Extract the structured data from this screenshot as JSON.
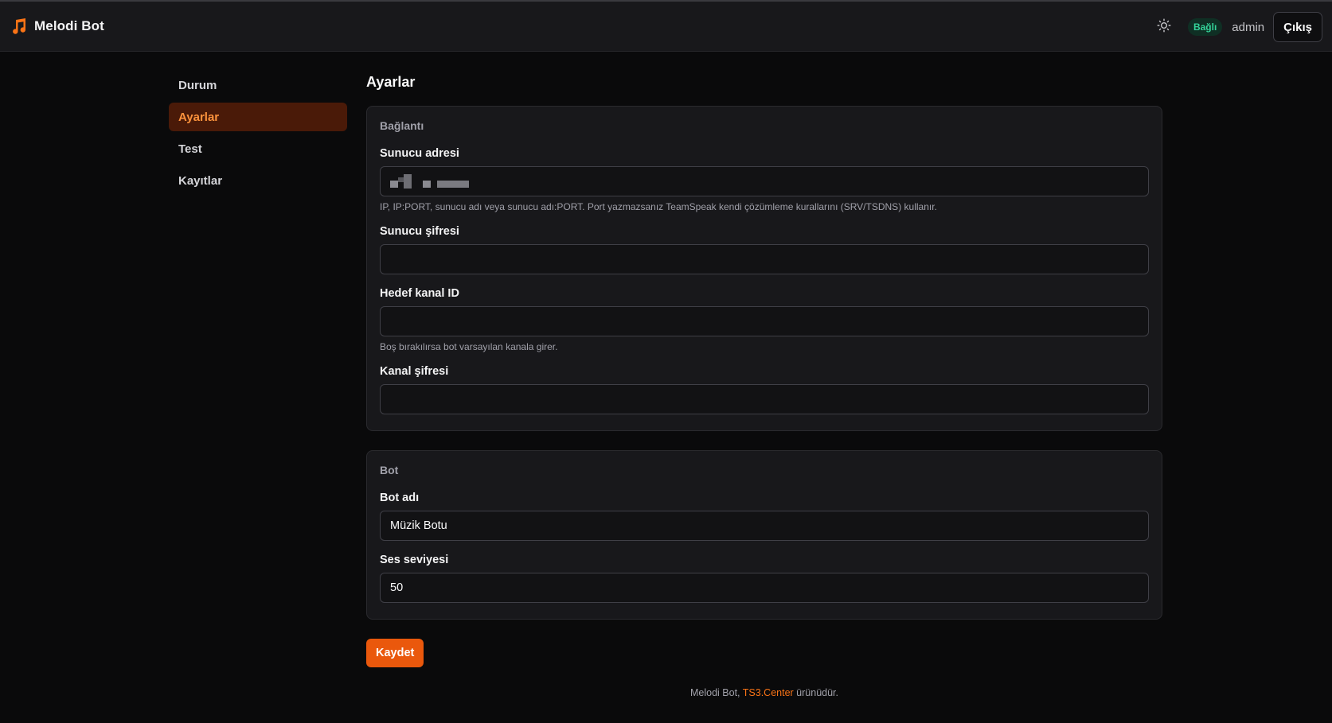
{
  "header": {
    "brand_name": "Melodi Bot",
    "brand_icon": "music-note-icon",
    "theme_icon": "sun-icon",
    "status_badge": "Bağlı",
    "username": "admin",
    "logout_label": "Çıkış"
  },
  "sidebar": {
    "items": [
      {
        "label": "Durum",
        "active": false
      },
      {
        "label": "Ayarlar",
        "active": true
      },
      {
        "label": "Test",
        "active": false
      },
      {
        "label": "Kayıtlar",
        "active": false
      }
    ]
  },
  "main": {
    "title": "Ayarlar",
    "connection": {
      "title": "Bağlantı",
      "server_address_label": "Sunucu adresi",
      "server_address_hint": "IP, IP:PORT, sunucu adı veya sunucu adı:PORT. Port yazmazsanız TeamSpeak kendi çözümleme kurallarını (SRV/TSDNS) kullanır.",
      "server_password_label": "Sunucu şifresi",
      "server_password_value": "",
      "channel_id_label": "Hedef kanal ID",
      "channel_id_value": "",
      "channel_id_hint": "Boş bırakılırsa bot varsayılan kanala girer.",
      "channel_password_label": "Kanal şifresi",
      "channel_password_value": ""
    },
    "bot": {
      "title": "Bot",
      "bot_name_label": "Bot adı",
      "bot_name_value": "Müzik Botu",
      "volume_label": "Ses seviyesi",
      "volume_value": "50"
    },
    "save_label": "Kaydet"
  },
  "footer": {
    "prefix": "Melodi Bot, ",
    "link": "TS3.Center",
    "suffix": " ürünüdür."
  },
  "colors": {
    "accent": "#ea580c",
    "active_nav_bg": "#4a1a08",
    "status_green": "#34d399",
    "background": "#0a0a0b",
    "surface": "#18181b"
  }
}
